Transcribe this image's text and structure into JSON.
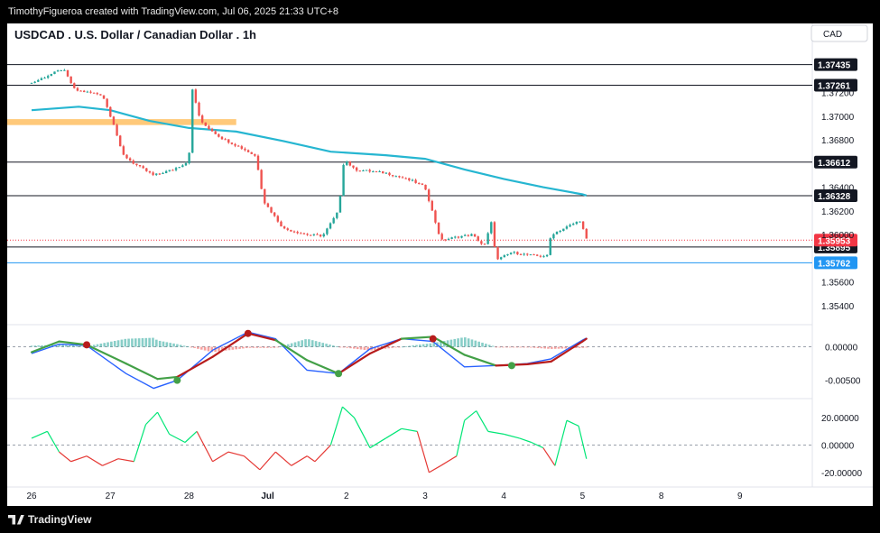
{
  "header": {
    "credit": "TimothyFigueroa created with TradingView.com, Jul 06, 2025 21:33 UTC+8",
    "symbol_title": "USDCAD . U.S. Dollar / Canadian Dollar . 1h",
    "currency": "CAD"
  },
  "footer": {
    "logo_text": "TradingView"
  },
  "colors": {
    "up": "#26a69a",
    "down": "#ef5350",
    "ma": "#26b6d1",
    "zone": "#ffb74d",
    "last_price": "#f23645",
    "blue_level": "#2196f3",
    "sig_green": "#43a047",
    "sig_red": "#b71c1c",
    "sig_blue": "#2962ff",
    "osc_green": "#00e676",
    "osc_red": "#e53935"
  },
  "chart_data": [
    {
      "type": "candlestick",
      "name": "price",
      "title": "USDCAD . U.S. Dollar / Canadian Dollar . 1h",
      "x_ticks": [
        "26",
        "27",
        "28",
        "Jul",
        "2",
        "3",
        "4",
        "5",
        "8",
        "9"
      ],
      "y_ticks": [
        "1.37200",
        "1.37000",
        "1.36800",
        "1.36400",
        "1.36200",
        "1.36000",
        "1.35600",
        "1.35400"
      ],
      "ylim": [
        1.3527,
        1.376
      ],
      "levels": [
        {
          "label": "1.37435",
          "value": 1.37435,
          "style": "black"
        },
        {
          "label": "1.37261",
          "value": 1.37261,
          "style": "black"
        },
        {
          "label": "1.36612",
          "value": 1.36612,
          "style": "black"
        },
        {
          "label": "1.36328",
          "value": 1.36328,
          "style": "black"
        },
        {
          "label": "1.35895",
          "value": 1.35895,
          "style": "black"
        },
        {
          "label": "1.35953",
          "value": 1.35953,
          "style": "last"
        },
        {
          "label": "1.35762",
          "value": 1.35762,
          "style": "blue"
        }
      ],
      "supply_zone": [
        1.36925,
        1.36975
      ],
      "path": [
        [
          0,
          1.3728
        ],
        [
          0.4,
          1.374
        ],
        [
          0.55,
          1.3722
        ],
        [
          0.9,
          1.3718
        ],
        [
          1.05,
          1.3692
        ],
        [
          1.15,
          1.3668
        ],
        [
          1.3,
          1.366
        ],
        [
          1.55,
          1.365
        ],
        [
          1.8,
          1.3655
        ],
        [
          2.0,
          1.3662
        ],
        [
          2.02,
          1.3728
        ],
        [
          2.15,
          1.3695
        ],
        [
          2.4,
          1.3682
        ],
        [
          2.7,
          1.3672
        ],
        [
          2.85,
          1.3666
        ],
        [
          2.95,
          1.3628
        ],
        [
          3.2,
          1.3605
        ],
        [
          3.5,
          1.36
        ],
        [
          3.7,
          1.3599
        ],
        [
          3.9,
          1.362
        ],
        [
          3.97,
          1.3664
        ],
        [
          4.1,
          1.3655
        ],
        [
          4.5,
          1.3652
        ],
        [
          4.85,
          1.3645
        ],
        [
          5.0,
          1.364
        ],
        [
          5.2,
          1.3595
        ],
        [
          5.4,
          1.3598
        ],
        [
          5.6,
          1.36
        ],
        [
          5.75,
          1.359
        ],
        [
          5.85,
          1.3612
        ],
        [
          5.9,
          1.3578
        ],
        [
          6.1,
          1.3585
        ],
        [
          6.4,
          1.3582
        ],
        [
          6.55,
          1.3582
        ],
        [
          6.6,
          1.36
        ],
        [
          6.85,
          1.3608
        ],
        [
          6.97,
          1.3612
        ],
        [
          7.05,
          1.3596
        ]
      ],
      "ma_path": [
        [
          0,
          1.3705
        ],
        [
          0.6,
          1.3708
        ],
        [
          1.0,
          1.3705
        ],
        [
          1.5,
          1.3696
        ],
        [
          2.0,
          1.369
        ],
        [
          2.6,
          1.3687
        ],
        [
          3.2,
          1.3679
        ],
        [
          3.8,
          1.367
        ],
        [
          4.5,
          1.3667
        ],
        [
          5.0,
          1.3664
        ],
        [
          5.5,
          1.3655
        ],
        [
          6.0,
          1.3647
        ],
        [
          6.5,
          1.364
        ],
        [
          7.0,
          1.3634
        ],
        [
          7.05,
          1.3633
        ]
      ]
    },
    {
      "type": "oscillator",
      "name": "signal-panel",
      "y_ticks": [
        "0.00000",
        "-0.00500"
      ],
      "ylim": [
        -0.0072,
        0.0025
      ],
      "line_a": [
        [
          0,
          -0.0008
        ],
        [
          0.35,
          0.0008
        ],
        [
          0.7,
          0.0003
        ],
        [
          1.2,
          -0.0025
        ],
        [
          1.6,
          -0.0048
        ],
        [
          1.85,
          -0.0045
        ],
        [
          2.3,
          -0.0015
        ],
        [
          2.75,
          0.002
        ],
        [
          3.1,
          0.001
        ],
        [
          3.5,
          -0.002
        ],
        [
          3.9,
          -0.004
        ],
        [
          4.3,
          -0.001
        ],
        [
          4.7,
          0.0012
        ],
        [
          5.1,
          0.0015
        ],
        [
          5.5,
          -0.0012
        ],
        [
          5.9,
          -0.0028
        ],
        [
          6.3,
          -0.0026
        ],
        [
          6.6,
          -0.0022
        ],
        [
          7.0,
          0.0008
        ],
        [
          7.05,
          0.0012
        ]
      ],
      "line_b": [
        [
          0,
          -0.001
        ],
        [
          0.35,
          0.0004
        ],
        [
          0.7,
          0.0002
        ],
        [
          1.2,
          -0.004
        ],
        [
          1.55,
          -0.0062
        ],
        [
          1.85,
          -0.005
        ],
        [
          2.3,
          -0.0005
        ],
        [
          2.75,
          0.0022
        ],
        [
          3.1,
          0.0012
        ],
        [
          3.5,
          -0.0035
        ],
        [
          3.9,
          -0.004
        ],
        [
          4.3,
          -0.0003
        ],
        [
          4.7,
          0.0012
        ],
        [
          5.1,
          0.0008
        ],
        [
          5.5,
          -0.003
        ],
        [
          5.9,
          -0.0028
        ],
        [
          6.3,
          -0.0025
        ],
        [
          6.6,
          -0.0018
        ],
        [
          7.0,
          0.001
        ],
        [
          7.05,
          0.0013
        ]
      ],
      "markers": [
        {
          "x": 0.7,
          "y": 0.0003,
          "kind": "red"
        },
        {
          "x": 1.85,
          "y": -0.005,
          "kind": "green"
        },
        {
          "x": 2.75,
          "y": 0.002,
          "kind": "red"
        },
        {
          "x": 3.9,
          "y": -0.004,
          "kind": "green"
        },
        {
          "x": 5.1,
          "y": 0.0012,
          "kind": "red"
        },
        {
          "x": 6.1,
          "y": -0.0028,
          "kind": "green"
        }
      ]
    },
    {
      "type": "line",
      "name": "momentum-panel",
      "y_ticks": [
        "20.00000",
        "0.00000",
        "-20.00000"
      ],
      "ylim": [
        -26,
        30
      ],
      "values": [
        [
          0,
          5
        ],
        [
          0.2,
          10
        ],
        [
          0.35,
          -5
        ],
        [
          0.5,
          -12
        ],
        [
          0.7,
          -8
        ],
        [
          0.9,
          -15
        ],
        [
          1.1,
          -10
        ],
        [
          1.3,
          -12
        ],
        [
          1.45,
          15
        ],
        [
          1.6,
          24
        ],
        [
          1.75,
          8
        ],
        [
          1.95,
          2
        ],
        [
          2.1,
          10
        ],
        [
          2.3,
          -12
        ],
        [
          2.5,
          -5
        ],
        [
          2.7,
          -8
        ],
        [
          2.9,
          -18
        ],
        [
          3.1,
          -5
        ],
        [
          3.3,
          -15
        ],
        [
          3.5,
          -8
        ],
        [
          3.6,
          -12
        ],
        [
          3.8,
          0
        ],
        [
          3.95,
          28
        ],
        [
          4.1,
          20
        ],
        [
          4.3,
          -2
        ],
        [
          4.5,
          5
        ],
        [
          4.7,
          12
        ],
        [
          4.9,
          10
        ],
        [
          5.05,
          -20
        ],
        [
          5.2,
          -15
        ],
        [
          5.4,
          -8
        ],
        [
          5.5,
          18
        ],
        [
          5.65,
          25
        ],
        [
          5.8,
          10
        ],
        [
          6.0,
          8
        ],
        [
          6.2,
          5
        ],
        [
          6.35,
          2
        ],
        [
          6.5,
          -2
        ],
        [
          6.65,
          -15
        ],
        [
          6.8,
          18
        ],
        [
          6.95,
          14
        ],
        [
          7.05,
          -10
        ]
      ]
    }
  ]
}
